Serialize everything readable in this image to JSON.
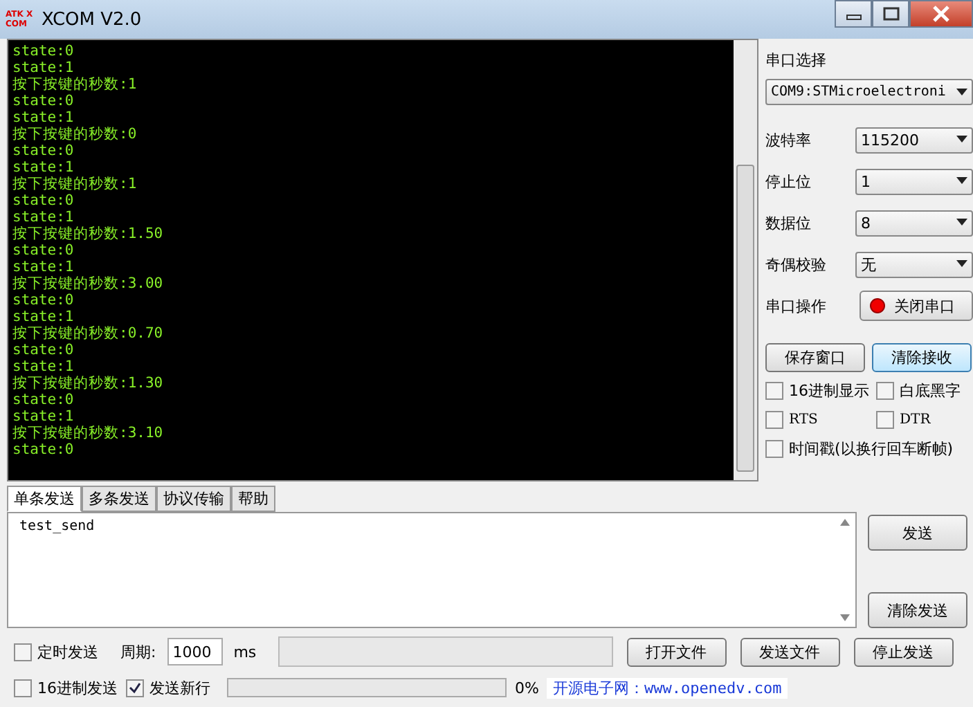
{
  "window": {
    "title": "XCOM V2.0",
    "logo": "ATK XCOM"
  },
  "receive_log": [
    "state:0",
    "state:1",
    "按下按键的秒数:1",
    "state:0",
    "state:1",
    "按下按键的秒数:0",
    "state:0",
    "state:1",
    "按下按键的秒数:1",
    "state:0",
    "state:1",
    "按下按键的秒数:1.50",
    "state:0",
    "state:1",
    "按下按键的秒数:3.00",
    "state:0",
    "state:1",
    "按下按键的秒数:0.70",
    "state:0",
    "state:1",
    "按下按键的秒数:1.30",
    "state:0",
    "state:1",
    "按下按键的秒数:3.10",
    "state:0"
  ],
  "port": {
    "label": "串口选择",
    "value": "COM9:STMicroelectroni"
  },
  "settings": [
    {
      "label": "波特率",
      "value": "115200"
    },
    {
      "label": "停止位",
      "value": "1"
    },
    {
      "label": "数据位",
      "value": "8"
    },
    {
      "label": "奇偶校验",
      "value": "无"
    }
  ],
  "operation": {
    "label": "串口操作",
    "button": "关闭串口",
    "open": true
  },
  "receive_buttons": [
    "保存窗口",
    "清除接收"
  ],
  "receive_options": [
    {
      "label": "16进制显示",
      "checked": false
    },
    {
      "label": "白底黑字",
      "checked": false
    },
    {
      "label": "RTS",
      "checked": false
    },
    {
      "label": "DTR",
      "checked": false
    },
    {
      "label": "时间戳(以换行回车断帧)",
      "checked": false
    }
  ],
  "tabs": [
    {
      "label": "单条发送",
      "selected": true
    },
    {
      "label": "多条发送",
      "selected": false
    },
    {
      "label": "协议传输",
      "selected": false
    },
    {
      "label": "帮助",
      "selected": false
    }
  ],
  "send_text": "test_send",
  "send_buttons": [
    "发送",
    "清除发送"
  ],
  "timed_send": {
    "label": "定时发送",
    "checked": false
  },
  "period": {
    "label": "周期:",
    "value": "1000",
    "unit": "ms"
  },
  "file_buttons": [
    "打开文件",
    "发送文件",
    "停止发送"
  ],
  "bottom_options": [
    {
      "label": "16进制发送",
      "checked": false
    },
    {
      "label": "发送新行",
      "checked": true
    }
  ],
  "progress": {
    "level": 0,
    "reading": "0%"
  },
  "banner": "开源电子网：www.openedv.com"
}
